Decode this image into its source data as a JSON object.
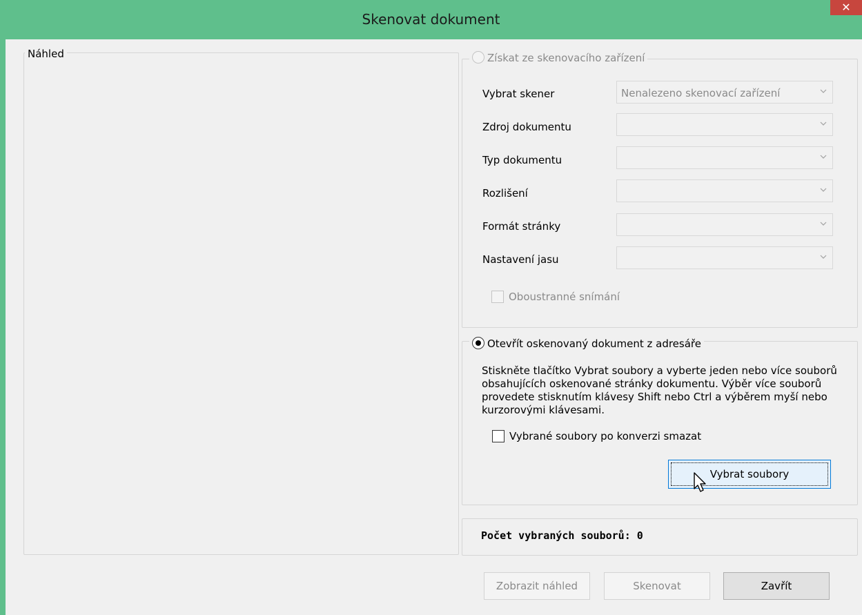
{
  "window": {
    "title": "Skenovat dokument",
    "close_glyph": "✕",
    "title_bar_color": "#5fbf8c",
    "close_button_color": "#c7463e"
  },
  "preview": {
    "label": "Náhled"
  },
  "scan_source": {
    "radio_label": "Získat ze skenovacího zařízení",
    "selected": false,
    "enabled": false,
    "fields": [
      {
        "label": "Vybrat skener",
        "value": "Nenalezeno skenovací zařízení"
      },
      {
        "label": "Zdroj dokumentu",
        "value": ""
      },
      {
        "label": "Typ dokumentu",
        "value": ""
      },
      {
        "label": "Rozlišení",
        "value": ""
      },
      {
        "label": "Formát stránky",
        "value": ""
      },
      {
        "label": "Nastavení jasu",
        "value": ""
      }
    ],
    "duplex_label": "Oboustranné snímání",
    "duplex_checked": false
  },
  "open_dir": {
    "radio_label": "Otevřít oskenovaný dokument z adresáře",
    "selected": true,
    "description": "Stiskněte tlačítko Vybrat soubory a vyberte jeden nebo více souborů obsahujících oskenované stránky dokumentu. Výběr více souborů provedete stisknutím klávesy Shift nebo Ctrl a výběrem myší nebo kurzorovými klávesami.",
    "delete_after_label": "Vybrané soubory po konverzi smazat",
    "delete_after_checked": false,
    "select_files_button": "Vybrat soubory"
  },
  "count": {
    "text": "Počet vybraných souborů: 0"
  },
  "buttons": {
    "preview": "Zobrazit náhled",
    "scan": "Skenovat",
    "close": "Zavřít"
  },
  "icons": {
    "close": "close-icon",
    "dropdown": "chevron-down-icon",
    "cursor": "mouse-pointer-icon"
  }
}
